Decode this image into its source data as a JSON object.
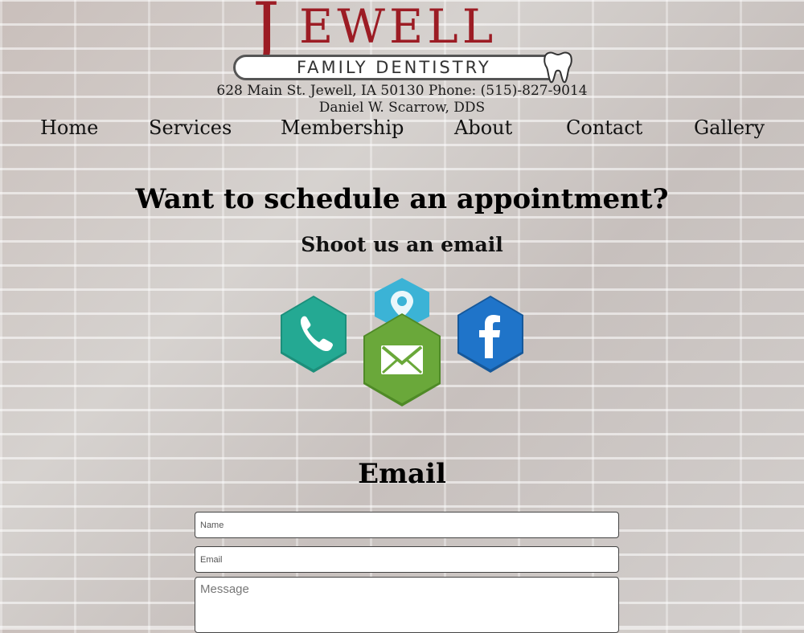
{
  "logo": {
    "initial": "J",
    "word": "EWELL",
    "subtitle": "FAMILY DENTISTRY",
    "brand_color": "#9c1c24"
  },
  "header": {
    "address_line": "628 Main St. Jewell, IA 50130 Phone: (515)-827-9014",
    "doctor_line": "Daniel W. Scarrow, DDS"
  },
  "nav": {
    "items": [
      {
        "label": "Home"
      },
      {
        "label": "Services"
      },
      {
        "label": "Membership"
      },
      {
        "label": "About"
      },
      {
        "label": "Contact"
      },
      {
        "label": "Gallery"
      }
    ]
  },
  "main": {
    "headline": "Want to schedule an appointment?",
    "subheadline": "Shoot us an email"
  },
  "contact_icons": {
    "phone": {
      "icon": "phone-icon",
      "color": "#22a690"
    },
    "location": {
      "icon": "location-pin-icon",
      "color": "#3bb3d6"
    },
    "email": {
      "icon": "envelope-icon",
      "color": "#6aa83a"
    },
    "facebook": {
      "icon": "facebook-icon",
      "color": "#1f74c9"
    }
  },
  "form": {
    "title": "Email",
    "name_placeholder": "Name",
    "email_placeholder": "Email",
    "message_placeholder": "Message"
  }
}
